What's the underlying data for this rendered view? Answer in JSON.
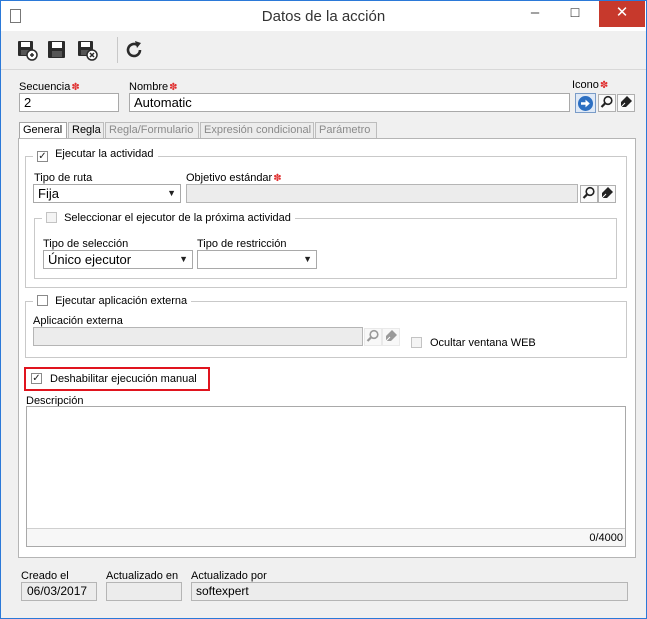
{
  "window": {
    "title": "Datos de la acción",
    "minimize": "–",
    "maximize": "☐",
    "close": "✕"
  },
  "toolbar": {
    "save_new": "Guardar y nuevo",
    "save": "Guardar",
    "save_close": "Guardar y salir",
    "refresh": "Actualizar"
  },
  "header": {
    "secuencia_label": "Secuencia",
    "secuencia_value": "2",
    "nombre_label": "Nombre",
    "nombre_value": "Automatic",
    "icono_label": "Icono"
  },
  "tabs": [
    {
      "label": "General",
      "state": "active"
    },
    {
      "label": "Regla",
      "state": "enabled"
    },
    {
      "label": "Regla/Formulario",
      "state": "disabled"
    },
    {
      "label": "Expresión condicional",
      "state": "disabled"
    },
    {
      "label": "Parámetro",
      "state": "disabled"
    }
  ],
  "activity": {
    "checkbox_label": "Ejecutar la actividad",
    "checked": true,
    "tipo_ruta_label": "Tipo de ruta",
    "tipo_ruta_value": "Fija",
    "objetivo_label": "Objetivo estándar",
    "objetivo_value": "",
    "next_executor_label": "Seleccionar el ejecutor de la próxima actividad",
    "next_executor_checked": false,
    "tipo_seleccion_label": "Tipo de selección",
    "tipo_seleccion_value": "Único ejecutor",
    "tipo_restriccion_label": "Tipo de restricción",
    "tipo_restriccion_value": ""
  },
  "external": {
    "checkbox_label": "Ejecutar aplicación externa",
    "checked": false,
    "app_label": "Aplicación externa",
    "app_value": "",
    "hide_web_label": "Ocultar ventana WEB",
    "hide_web_checked": false
  },
  "manual": {
    "label": "Deshabilitar ejecución manual",
    "checked": true
  },
  "description": {
    "label": "Descripción",
    "value": "",
    "counter": "0/4000"
  },
  "footer": {
    "creado_label": "Creado el",
    "creado_value": "06/03/2017",
    "actualizado_label": "Actualizado en",
    "actualizado_value": "",
    "actualizado_por_label": "Actualizado por",
    "actualizado_por_value": "softexpert"
  },
  "colors": {
    "highlight": "#e0141e",
    "accent": "#2b79d8",
    "required": "#e03030"
  },
  "icons": [
    "save-new-icon",
    "save-icon",
    "save-close-icon",
    "refresh-icon",
    "arrow-right-icon",
    "search-icon",
    "eraser-icon",
    "required-icon"
  ]
}
